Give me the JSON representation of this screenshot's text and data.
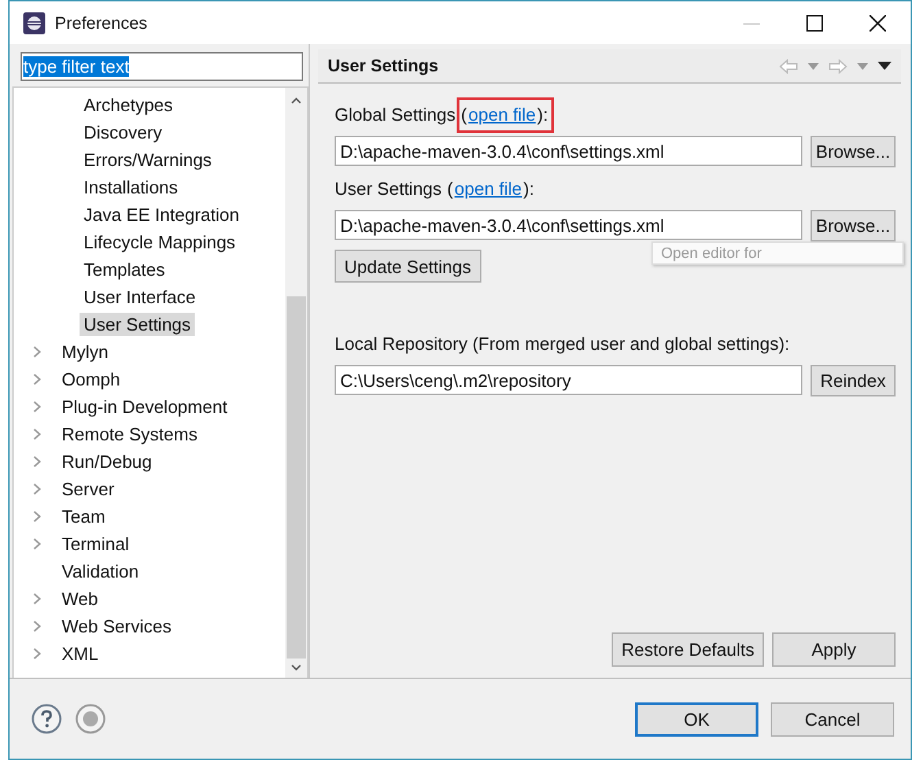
{
  "window": {
    "title": "Preferences"
  },
  "filter": {
    "value": "type filter text",
    "text_selected": true
  },
  "tree": {
    "items": [
      {
        "children": [
          {
            "label": "Archetypes",
            "selected": false
          },
          {
            "label": "Discovery",
            "selected": false
          },
          {
            "label": "Errors/Warnings",
            "selected": false
          },
          {
            "label": "Installations",
            "selected": false
          },
          {
            "label": "Java EE Integration",
            "selected": false
          },
          {
            "label": "Lifecycle Mappings",
            "selected": false
          },
          {
            "label": "Templates",
            "selected": false
          },
          {
            "label": "User Interface",
            "selected": false
          },
          {
            "label": "User Settings",
            "selected": true
          }
        ]
      },
      {
        "label": "Mylyn",
        "expandable": true,
        "selected": false
      },
      {
        "label": "Oomph",
        "expandable": true,
        "selected": false
      },
      {
        "label": "Plug-in Development",
        "expandable": true,
        "selected": false
      },
      {
        "label": "Remote Systems",
        "expandable": true,
        "selected": false
      },
      {
        "label": "Run/Debug",
        "expandable": true,
        "selected": false
      },
      {
        "label": "Server",
        "expandable": true,
        "selected": false
      },
      {
        "label": "Team",
        "expandable": true,
        "selected": false
      },
      {
        "label": "Terminal",
        "expandable": true,
        "selected": false
      },
      {
        "label": "Validation",
        "expandable": false,
        "selected": false
      },
      {
        "label": "Web",
        "expandable": true,
        "selected": false
      },
      {
        "label": "Web Services",
        "expandable": true,
        "selected": false
      },
      {
        "label": "XML",
        "expandable": true,
        "selected": false
      }
    ]
  },
  "page": {
    "title": "User Settings",
    "sections": [
      {
        "label": "Global Settings",
        "prefix": "(",
        "link": "open file",
        "suffix": "):",
        "link_highlighted": true,
        "path": "D:\\apache-maven-3.0.4\\conf\\settings.xml",
        "button": "Browse..."
      },
      {
        "label": "User Settings",
        "prefix": "(",
        "link": "open file",
        "suffix": "):",
        "link_highlighted": false,
        "path": "D:\\apache-maven-3.0.4\\conf\\settings.xml",
        "button": "Browse...",
        "tooltip": "Open editor for"
      }
    ],
    "update_button": "Update Settings",
    "repo_label": "Local Repository (From merged user and global settings):",
    "repo_path": "C:\\Users\\ceng\\.m2\\repository",
    "repo_button": "Reindex",
    "buttons": [
      "Restore Defaults",
      "Apply"
    ]
  },
  "dialog_buttons": [
    {
      "label": "OK",
      "default": true
    },
    {
      "label": "Cancel",
      "default": false
    }
  ]
}
